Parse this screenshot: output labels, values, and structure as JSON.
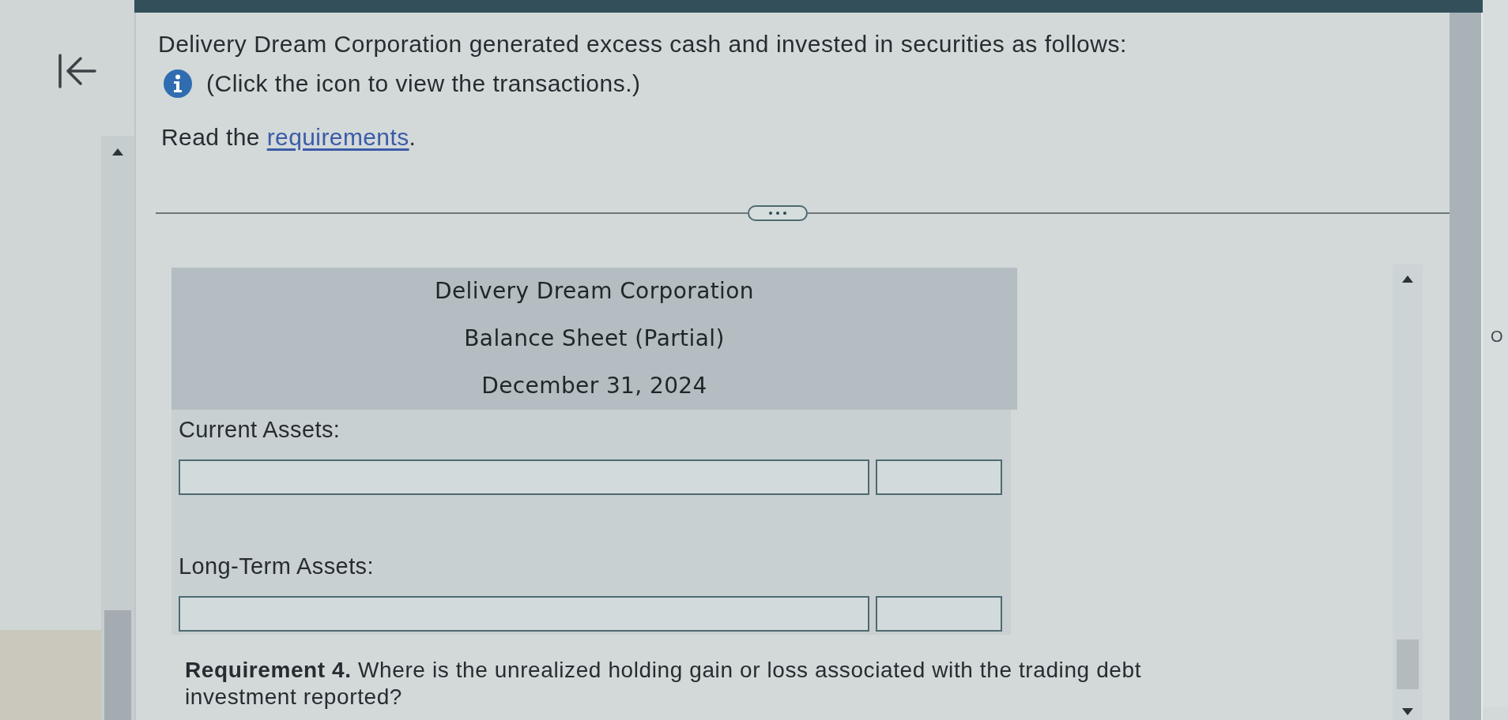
{
  "intro": {
    "text": "Delivery Dream Corporation generated excess cash and invested in securities as follows:",
    "info_text": "(Click the icon to view the transactions.)",
    "read": {
      "before": "Read the ",
      "link": "requirements",
      "after": "."
    }
  },
  "statement": {
    "header": [
      "Delivery Dream Corporation",
      "Balance Sheet (Partial)",
      "December 31, 2024"
    ],
    "sections": [
      {
        "label": "Current Assets:",
        "fields": [
          {
            "kind": "account"
          },
          {
            "kind": "amount"
          }
        ]
      },
      {
        "label": "Long-Term Assets:",
        "fields": [
          {
            "kind": "account"
          },
          {
            "kind": "amount"
          }
        ]
      }
    ]
  },
  "requirement": {
    "text": "**Requirement 4.** Where is the unrealized holding gain or loss associated with the trading debt investment reported?"
  },
  "side_panel": {
    "text": "O"
  }
}
